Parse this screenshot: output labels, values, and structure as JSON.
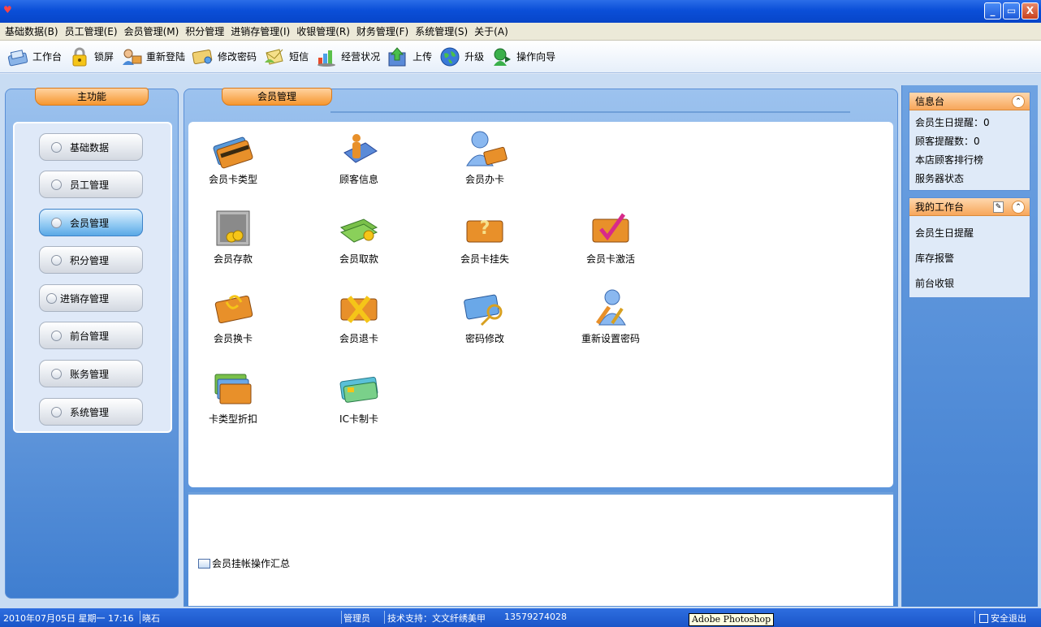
{
  "window": {
    "minimize": "_",
    "restore": "▭",
    "close": "X"
  },
  "menu": [
    "基础数据(B)",
    "员工管理(E)",
    "会员管理(M)",
    "积分管理",
    "进销存管理(I)",
    "收银管理(R)",
    "财务管理(F)",
    "系统管理(S)",
    "关于(A)"
  ],
  "toolbar": [
    {
      "label": "工作台",
      "icon": "desk-icon"
    },
    {
      "label": "锁屏",
      "icon": "lock-icon"
    },
    {
      "label": "重新登陆",
      "icon": "relogin-icon"
    },
    {
      "label": "修改密码",
      "icon": "password-icon"
    },
    {
      "label": "短信",
      "icon": "sms-icon"
    },
    {
      "label": "经营状况",
      "icon": "chart-icon"
    },
    {
      "label": "上传",
      "icon": "upload-icon"
    },
    {
      "label": "升级",
      "icon": "globe-icon"
    },
    {
      "label": "操作向导",
      "icon": "guide-icon"
    }
  ],
  "left": {
    "title": "主功能",
    "items": [
      "基础数据",
      "员工管理",
      "会员管理",
      "积分管理",
      "进销存管理",
      "前台管理",
      "账务管理",
      "系统管理"
    ],
    "active_index": 2
  },
  "center": {
    "title": "会员管理",
    "functions": [
      {
        "label": "会员卡类型",
        "icon": "card-type-icon"
      },
      {
        "label": "顾客信息",
        "icon": "customer-info-icon"
      },
      {
        "label": "会员办卡",
        "icon": "issue-card-icon"
      },
      {
        "label": "会员存款",
        "icon": "deposit-icon"
      },
      {
        "label": "会员取款",
        "icon": "withdraw-icon"
      },
      {
        "label": "会员卡挂失",
        "icon": "report-loss-icon"
      },
      {
        "label": "会员卡激活",
        "icon": "activate-icon"
      },
      {
        "label": "会员换卡",
        "icon": "exchange-card-icon"
      },
      {
        "label": "会员退卡",
        "icon": "return-card-icon"
      },
      {
        "label": "密码修改",
        "icon": "change-password-icon"
      },
      {
        "label": "重新设置密码",
        "icon": "reset-password-icon"
      },
      {
        "label": "卡类型折扣",
        "icon": "discount-icon"
      },
      {
        "label": "IC卡制卡",
        "icon": "ic-card-icon"
      }
    ],
    "summary_link": "会员挂帐操作汇总"
  },
  "info_panel": {
    "title": "信息台",
    "items": [
      "会员生日提醒：0",
      "顾客提醒数：0",
      "本店顾客排行榜",
      "服务器状态"
    ]
  },
  "workbench": {
    "title": "我的工作台",
    "items": [
      "会员生日提醒",
      "库存报警",
      "前台收银"
    ]
  },
  "status": {
    "datetime": "2010年07月05日 星期一 17:16",
    "store": "晓石",
    "user": "管理员",
    "support": "技术支持：文文纤绣美甲",
    "phone": "13579274028",
    "exit": "安全退出"
  },
  "tooltip": "Adobe Photoshop",
  "colors": {
    "accent_orange": "#f6962f",
    "panel_blue": "#4c89d6",
    "title_blue": "#0b4fd8"
  }
}
